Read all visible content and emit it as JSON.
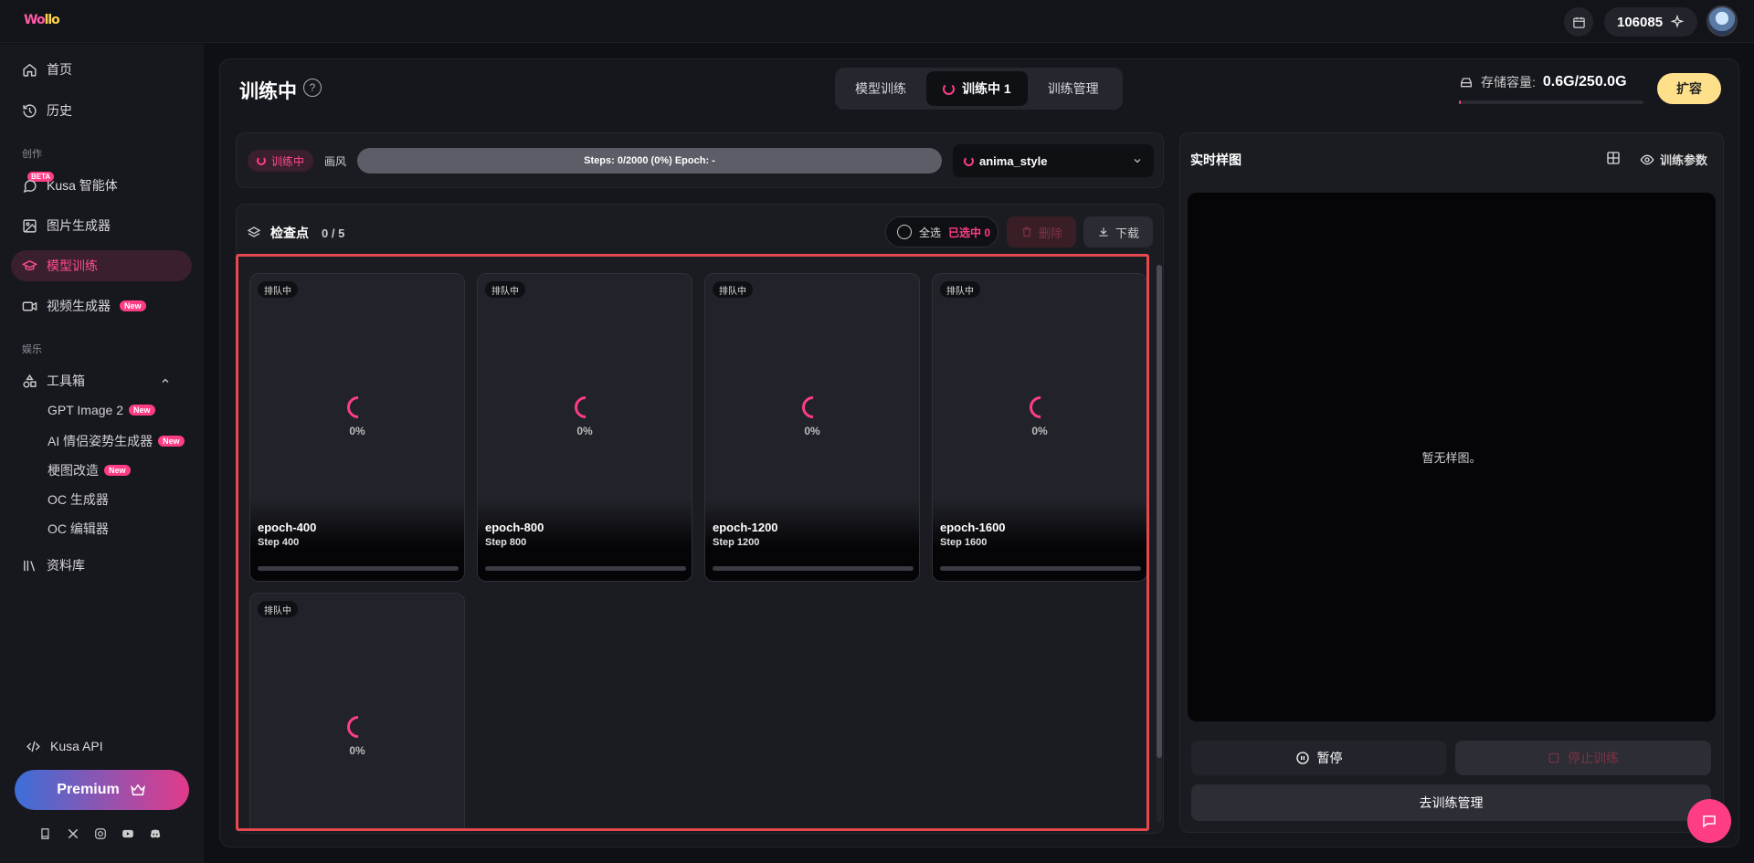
{
  "topbar": {
    "logo": "Wollo",
    "points": "106085"
  },
  "sidebar": {
    "home": "首页",
    "history": "历史",
    "section_create": "创作",
    "beta_badge": "BETA",
    "agent": "Kusa 智能体",
    "image_gen": "图片生成器",
    "model_train": "模型训练",
    "video_gen": "视频生成器",
    "new_badge": "New",
    "section_fun": "娱乐",
    "toolbox": "工具箱",
    "tools": [
      {
        "label": "GPT Image 2",
        "new": true
      },
      {
        "label": "AI 情侣姿势生成器",
        "new": true
      },
      {
        "label": "梗图改造",
        "new": true
      },
      {
        "label": "OC 生成器",
        "new": false
      },
      {
        "label": "OC 编辑器",
        "new": false
      }
    ],
    "library": "资料库",
    "api": "Kusa API",
    "premium": "Premium"
  },
  "header": {
    "title": "训练中",
    "tabs": [
      "模型训练",
      "训练中 1",
      "训练管理"
    ],
    "storage_label": "存储容量:",
    "storage_value": "0.6G/250.0G",
    "storage_fraction": 0.0024,
    "expand": "扩容"
  },
  "status": {
    "pill": "训练中",
    "style_label": "画风",
    "progress_text": "Steps: 0/2000 (0%)  Epoch: -",
    "progress_fraction": 0,
    "model": "anima_style"
  },
  "checkpoints": {
    "title": "检查点",
    "count": "0 / 5",
    "select_all": "全选",
    "selected": "已选中 0",
    "delete": "删除",
    "download": "下载",
    "items": [
      {
        "queue": "排队中",
        "pct": "0%",
        "name": "epoch-400",
        "step": "Step 400",
        "progress": 0
      },
      {
        "queue": "排队中",
        "pct": "0%",
        "name": "epoch-800",
        "step": "Step 800",
        "progress": 0
      },
      {
        "queue": "排队中",
        "pct": "0%",
        "name": "epoch-1200",
        "step": "Step 1200",
        "progress": 0
      },
      {
        "queue": "排队中",
        "pct": "0%",
        "name": "epoch-1600",
        "step": "Step 1600",
        "progress": 0
      },
      {
        "queue": "排队中",
        "pct": "0%",
        "name": "",
        "step": "",
        "progress": 0
      }
    ]
  },
  "samples": {
    "title": "实时样图",
    "params": "训练参数",
    "empty": "暂无样图。",
    "pause": "暂停",
    "stop": "停止训练",
    "manage": "去训练管理"
  },
  "colors": {
    "accent": "#ff3d84",
    "premium_start": "#3b6fd8",
    "premium_end": "#e23a8a",
    "expand": "#ffe08a"
  }
}
